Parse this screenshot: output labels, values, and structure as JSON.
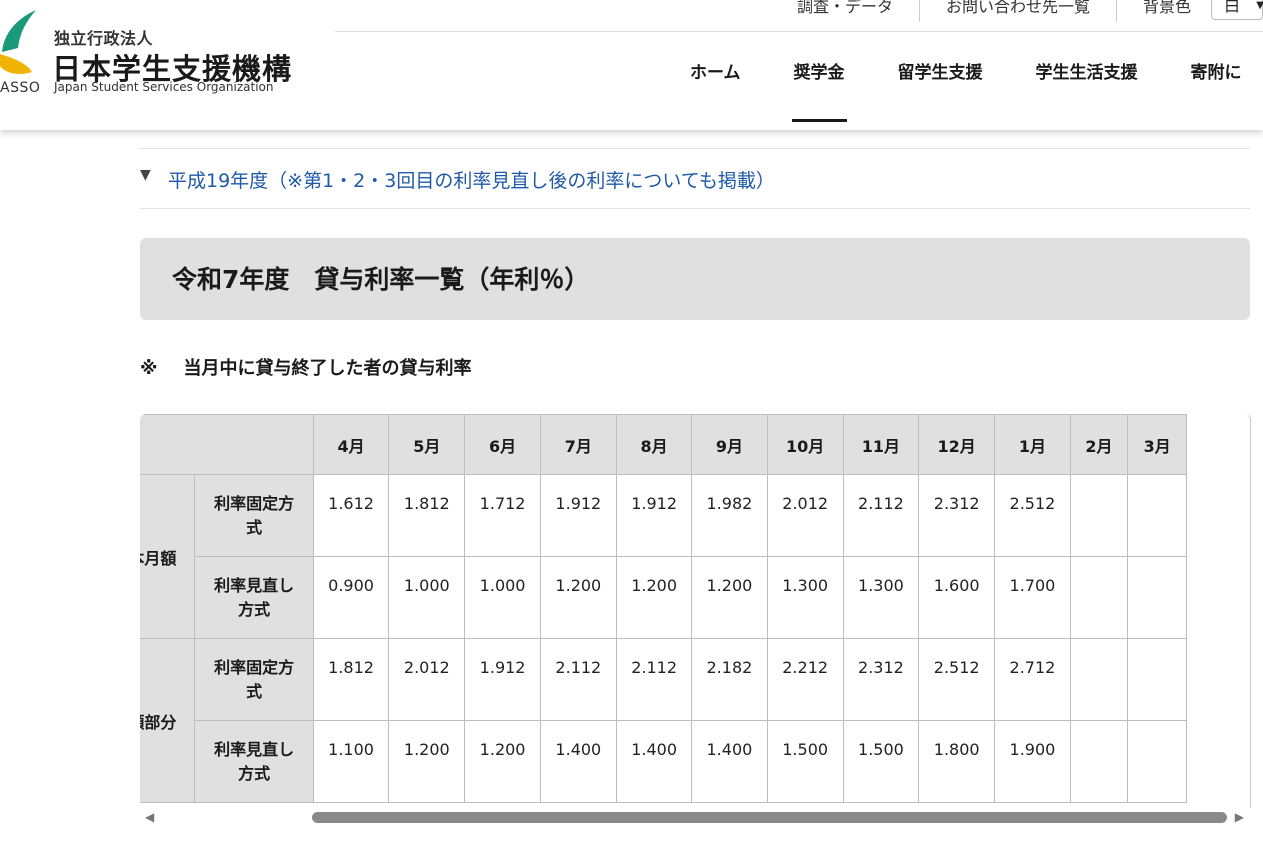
{
  "header": {
    "logo_small": "独立行政法人",
    "logo_main": "日本学生支援機構",
    "logo_asso": "ASSO",
    "logo_en": "Japan Student Services Organization",
    "util_links": [
      "調査・データ",
      "お問い合わせ先一覧",
      "背景色"
    ],
    "bg_select_value": "白",
    "nav": [
      "ホーム",
      "奨学金",
      "留学生支援",
      "学生生活支援",
      "寄附に"
    ]
  },
  "accordion": {
    "icon": "triangle-down-icon",
    "link": "平成19年度（※第1・2・3回目の利率見直し後の利率についても掲載）"
  },
  "section_title": "令和7年度　貸与利率一覧（年利％）",
  "note": {
    "mark": "※",
    "text": "当月中に貸与終了した者の貸与利率"
  },
  "table": {
    "months": [
      "4月",
      "5月",
      "6月",
      "7月",
      "8月",
      "9月",
      "10月",
      "11月",
      "12月",
      "1月",
      "2月",
      "3月"
    ],
    "groups": [
      {
        "label": "基本月額",
        "rows": [
          {
            "label": "利率固定方式",
            "values": [
              "1.612",
              "1.812",
              "1.712",
              "1.912",
              "1.912",
              "1.982",
              "2.012",
              "2.112",
              "2.312",
              "2.512",
              "",
              ""
            ]
          },
          {
            "label": "利率見直し方式",
            "values": [
              "0.900",
              "1.000",
              "1.000",
              "1.200",
              "1.200",
              "1.200",
              "1.300",
              "1.300",
              "1.600",
              "1.700",
              "",
              ""
            ]
          }
        ]
      },
      {
        "label": "増額部分",
        "rows": [
          {
            "label": "利率固定方式",
            "values": [
              "1.812",
              "2.012",
              "1.912",
              "2.112",
              "2.112",
              "2.182",
              "2.212",
              "2.312",
              "2.512",
              "2.712",
              "",
              ""
            ]
          },
          {
            "label": "利率見直し方式",
            "values": [
              "1.100",
              "1.200",
              "1.200",
              "1.400",
              "1.400",
              "1.400",
              "1.500",
              "1.500",
              "1.800",
              "1.900",
              "",
              ""
            ]
          }
        ]
      }
    ]
  },
  "colors": {
    "link": "#1f5aa8",
    "header_bg": "#e0e0e0",
    "logo_green": "#1a9a7a",
    "logo_yellow": "#f0b400"
  }
}
